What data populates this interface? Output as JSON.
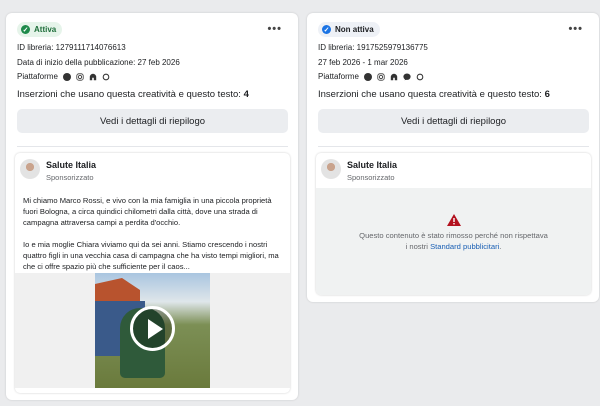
{
  "cards": [
    {
      "status": "Attiva",
      "library_id": "ID libreria: 1279111714076613",
      "date": "Data di inizio della pubblicazione: 27 feb 2026",
      "platforms_label": "Piattaforme",
      "platforms": [
        "facebook-icon",
        "instagram-icon",
        "audience-network-icon",
        "threads-icon"
      ],
      "count_label": "Inserzioni che usano questa creatività e questo testo:",
      "count": "4",
      "button": "Vedi i dettagli di riepilogo",
      "ad": {
        "page": "Salute Italia",
        "sponsored": "Sponsorizzato",
        "paragraphs": [
          "Mi chiamo Marco Rossi, e vivo con la mia famiglia in una piccola proprietà fuori Bologna, a circa quindici chilometri dalla città, dove una strada di campagna attraversa campi a perdita d'occhio.",
          "Io e mia moglie Chiara viviamo qui da sei anni. Stiamo crescendo i nostri quattro figli in una vecchia casa di campagna che ha visto tempi migliori, ma che ci offre spazio più che sufficiente per il caos..."
        ]
      }
    },
    {
      "status": "Non attiva",
      "library_id": "ID libreria: 1917525979136775",
      "date": "27 feb 2026 - 1 mar 2026",
      "platforms_label": "Piattaforme",
      "platforms": [
        "facebook-icon",
        "instagram-icon",
        "audience-network-icon",
        "messenger-icon",
        "threads-icon"
      ],
      "count_label": "Inserzioni che usano questa creatività e questo testo:",
      "count": "6",
      "button": "Vedi i dettagli di riepilogo",
      "ad": {
        "page": "Salute Italia",
        "sponsored": "Sponsorizzato",
        "removed_text": "Questo contenuto è stato rimosso perché non rispettava",
        "removed_prefix": "i nostri",
        "removed_link": "Standard pubblicitari",
        "removed_suffix": "."
      }
    }
  ],
  "more_label": "•••"
}
